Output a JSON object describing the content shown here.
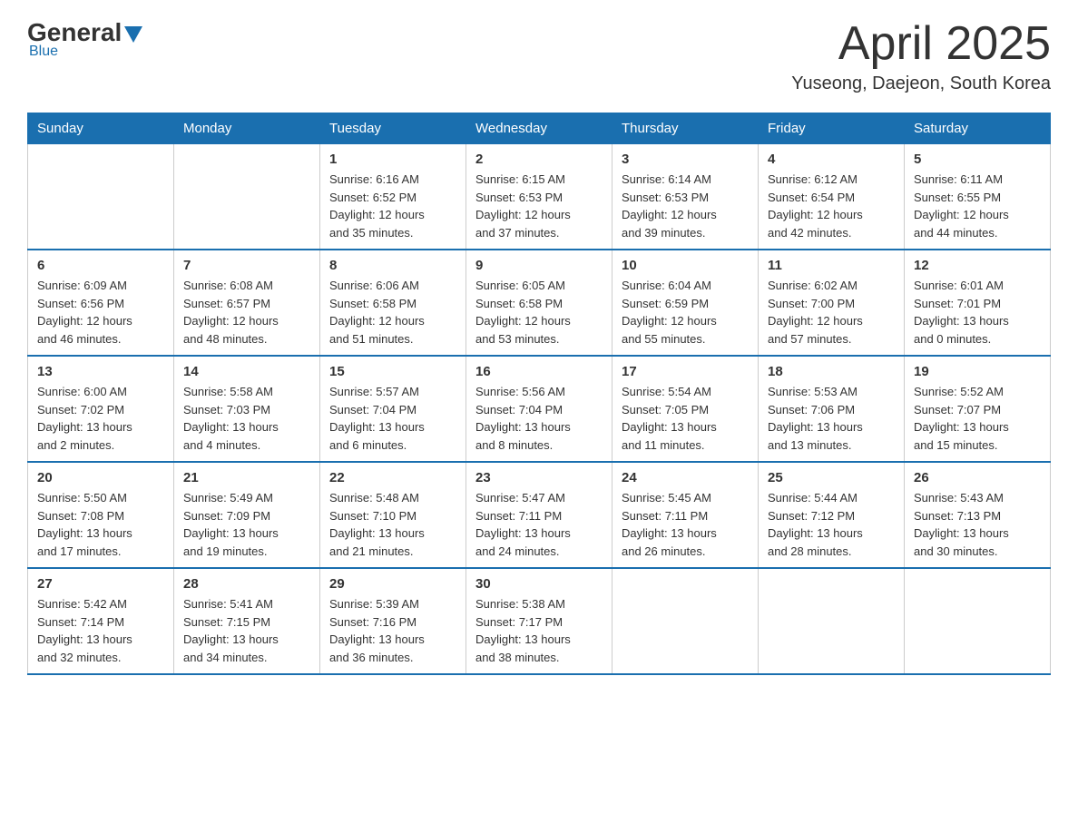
{
  "logo": {
    "general": "General",
    "blue": "Blue",
    "tagline": "Blue"
  },
  "header": {
    "title": "April 2025",
    "subtitle": "Yuseong, Daejeon, South Korea"
  },
  "weekdays": [
    "Sunday",
    "Monday",
    "Tuesday",
    "Wednesday",
    "Thursday",
    "Friday",
    "Saturday"
  ],
  "weeks": [
    [
      {
        "day": "",
        "info": ""
      },
      {
        "day": "",
        "info": ""
      },
      {
        "day": "1",
        "info": "Sunrise: 6:16 AM\nSunset: 6:52 PM\nDaylight: 12 hours\nand 35 minutes."
      },
      {
        "day": "2",
        "info": "Sunrise: 6:15 AM\nSunset: 6:53 PM\nDaylight: 12 hours\nand 37 minutes."
      },
      {
        "day": "3",
        "info": "Sunrise: 6:14 AM\nSunset: 6:53 PM\nDaylight: 12 hours\nand 39 minutes."
      },
      {
        "day": "4",
        "info": "Sunrise: 6:12 AM\nSunset: 6:54 PM\nDaylight: 12 hours\nand 42 minutes."
      },
      {
        "day": "5",
        "info": "Sunrise: 6:11 AM\nSunset: 6:55 PM\nDaylight: 12 hours\nand 44 minutes."
      }
    ],
    [
      {
        "day": "6",
        "info": "Sunrise: 6:09 AM\nSunset: 6:56 PM\nDaylight: 12 hours\nand 46 minutes."
      },
      {
        "day": "7",
        "info": "Sunrise: 6:08 AM\nSunset: 6:57 PM\nDaylight: 12 hours\nand 48 minutes."
      },
      {
        "day": "8",
        "info": "Sunrise: 6:06 AM\nSunset: 6:58 PM\nDaylight: 12 hours\nand 51 minutes."
      },
      {
        "day": "9",
        "info": "Sunrise: 6:05 AM\nSunset: 6:58 PM\nDaylight: 12 hours\nand 53 minutes."
      },
      {
        "day": "10",
        "info": "Sunrise: 6:04 AM\nSunset: 6:59 PM\nDaylight: 12 hours\nand 55 minutes."
      },
      {
        "day": "11",
        "info": "Sunrise: 6:02 AM\nSunset: 7:00 PM\nDaylight: 12 hours\nand 57 minutes."
      },
      {
        "day": "12",
        "info": "Sunrise: 6:01 AM\nSunset: 7:01 PM\nDaylight: 13 hours\nand 0 minutes."
      }
    ],
    [
      {
        "day": "13",
        "info": "Sunrise: 6:00 AM\nSunset: 7:02 PM\nDaylight: 13 hours\nand 2 minutes."
      },
      {
        "day": "14",
        "info": "Sunrise: 5:58 AM\nSunset: 7:03 PM\nDaylight: 13 hours\nand 4 minutes."
      },
      {
        "day": "15",
        "info": "Sunrise: 5:57 AM\nSunset: 7:04 PM\nDaylight: 13 hours\nand 6 minutes."
      },
      {
        "day": "16",
        "info": "Sunrise: 5:56 AM\nSunset: 7:04 PM\nDaylight: 13 hours\nand 8 minutes."
      },
      {
        "day": "17",
        "info": "Sunrise: 5:54 AM\nSunset: 7:05 PM\nDaylight: 13 hours\nand 11 minutes."
      },
      {
        "day": "18",
        "info": "Sunrise: 5:53 AM\nSunset: 7:06 PM\nDaylight: 13 hours\nand 13 minutes."
      },
      {
        "day": "19",
        "info": "Sunrise: 5:52 AM\nSunset: 7:07 PM\nDaylight: 13 hours\nand 15 minutes."
      }
    ],
    [
      {
        "day": "20",
        "info": "Sunrise: 5:50 AM\nSunset: 7:08 PM\nDaylight: 13 hours\nand 17 minutes."
      },
      {
        "day": "21",
        "info": "Sunrise: 5:49 AM\nSunset: 7:09 PM\nDaylight: 13 hours\nand 19 minutes."
      },
      {
        "day": "22",
        "info": "Sunrise: 5:48 AM\nSunset: 7:10 PM\nDaylight: 13 hours\nand 21 minutes."
      },
      {
        "day": "23",
        "info": "Sunrise: 5:47 AM\nSunset: 7:11 PM\nDaylight: 13 hours\nand 24 minutes."
      },
      {
        "day": "24",
        "info": "Sunrise: 5:45 AM\nSunset: 7:11 PM\nDaylight: 13 hours\nand 26 minutes."
      },
      {
        "day": "25",
        "info": "Sunrise: 5:44 AM\nSunset: 7:12 PM\nDaylight: 13 hours\nand 28 minutes."
      },
      {
        "day": "26",
        "info": "Sunrise: 5:43 AM\nSunset: 7:13 PM\nDaylight: 13 hours\nand 30 minutes."
      }
    ],
    [
      {
        "day": "27",
        "info": "Sunrise: 5:42 AM\nSunset: 7:14 PM\nDaylight: 13 hours\nand 32 minutes."
      },
      {
        "day": "28",
        "info": "Sunrise: 5:41 AM\nSunset: 7:15 PM\nDaylight: 13 hours\nand 34 minutes."
      },
      {
        "day": "29",
        "info": "Sunrise: 5:39 AM\nSunset: 7:16 PM\nDaylight: 13 hours\nand 36 minutes."
      },
      {
        "day": "30",
        "info": "Sunrise: 5:38 AM\nSunset: 7:17 PM\nDaylight: 13 hours\nand 38 minutes."
      },
      {
        "day": "",
        "info": ""
      },
      {
        "day": "",
        "info": ""
      },
      {
        "day": "",
        "info": ""
      }
    ]
  ]
}
